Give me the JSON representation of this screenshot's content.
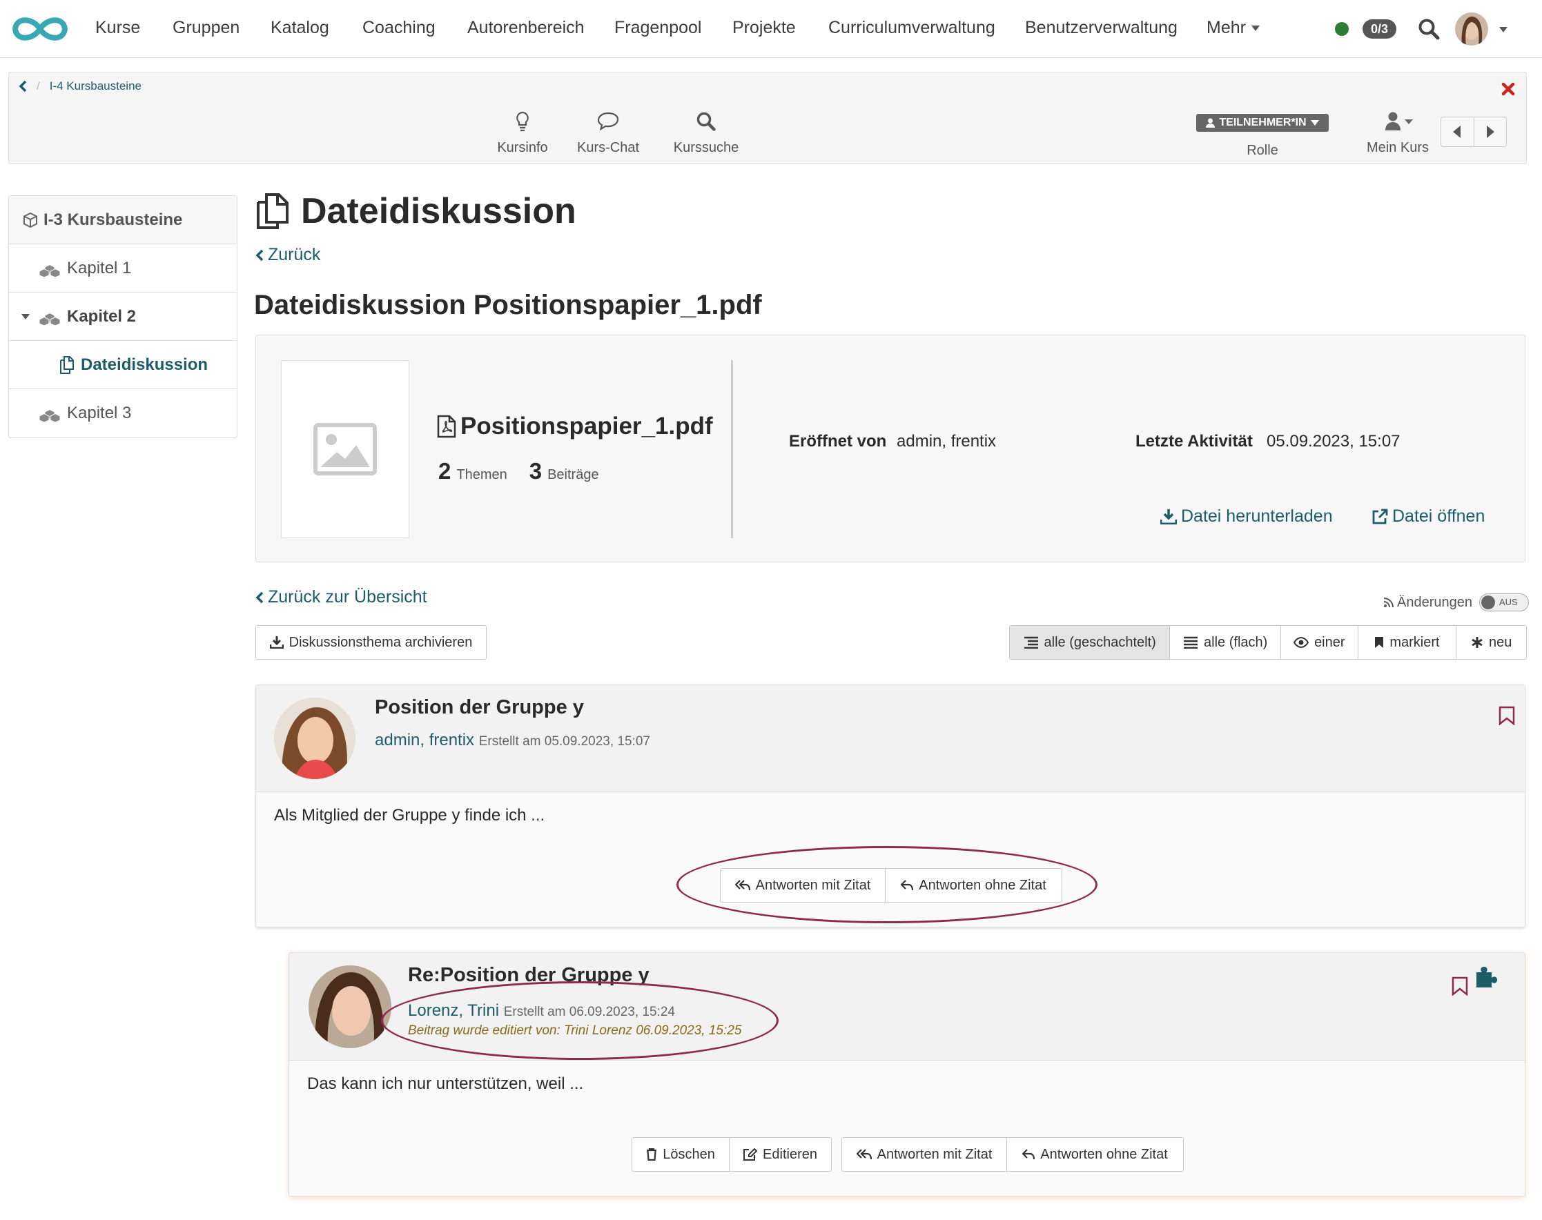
{
  "topnav": {
    "items": [
      "Kurse",
      "Gruppen",
      "Katalog",
      "Coaching",
      "Autorenbereich",
      "Fragenpool",
      "Projekte",
      "Curriculumverwaltung",
      "Benutzerverwaltung",
      "Mehr"
    ],
    "badge": "0/3",
    "status_color": "#2e7d32"
  },
  "toolbar": {
    "breadcrumb": "I-4 Kursbausteine",
    "tools": [
      "Kursinfo",
      "Kurs-Chat",
      "Kurssuche"
    ],
    "role_badge": "TEILNEHMER*IN",
    "role_label": "Rolle",
    "mycourse_label": "Mein Kurs"
  },
  "sidebar": {
    "items": [
      {
        "label": "I-3 Kursbausteine"
      },
      {
        "label": "Kapitel 1"
      },
      {
        "label": "Kapitel 2"
      },
      {
        "label": "Dateidiskussion"
      },
      {
        "label": "Kapitel 3"
      }
    ]
  },
  "main": {
    "title": "Dateidiskussion",
    "back": "Zurück",
    "subtitle": "Dateidiskussion Positionspapier_1.pdf",
    "file": {
      "name": "Positionspapier_1.pdf",
      "themes_count": "2",
      "themes_label": "Themen",
      "posts_count": "3",
      "posts_label": "Beiträge",
      "opened_by_label": "Eröffnet von",
      "opened_by": "admin, frentix",
      "last_activity_label": "Letzte Aktivität",
      "last_activity": "05.09.2023, 15:07",
      "download": "Datei herunterladen",
      "open": "Datei öffnen"
    },
    "back_overview": "Zurück zur Übersicht",
    "changes_label": "Änderungen",
    "toggle_label": "AUS",
    "archive_button": "Diskussionsthema archivieren",
    "filters": [
      "alle (geschachtelt)",
      "alle (flach)",
      "einer",
      "markiert",
      "neu"
    ]
  },
  "posts": [
    {
      "title": "Position der Gruppe y",
      "author": "admin, frentix",
      "created": "Erstellt am 05.09.2023, 15:07",
      "body": "Als Mitglied der Gruppe y finde ich ...",
      "actions": [
        "Antworten mit Zitat",
        "Antworten ohne Zitat"
      ]
    },
    {
      "title": "Re:Position der Gruppe y",
      "author": "Lorenz, Trini",
      "created": "Erstellt am 06.09.2023, 15:24",
      "edited": "Beitrag wurde editiert von: Trini Lorenz 06.09.2023, 15:25",
      "body": "Das kann ich nur unterstützen, weil ...",
      "actions": [
        "Löschen",
        "Editieren",
        "Antworten mit Zitat",
        "Antworten ohne Zitat"
      ]
    }
  ],
  "colors": {
    "link": "#1c5d69",
    "highlight": "#8e2a4e",
    "bookmark": "#8e2a4e"
  }
}
